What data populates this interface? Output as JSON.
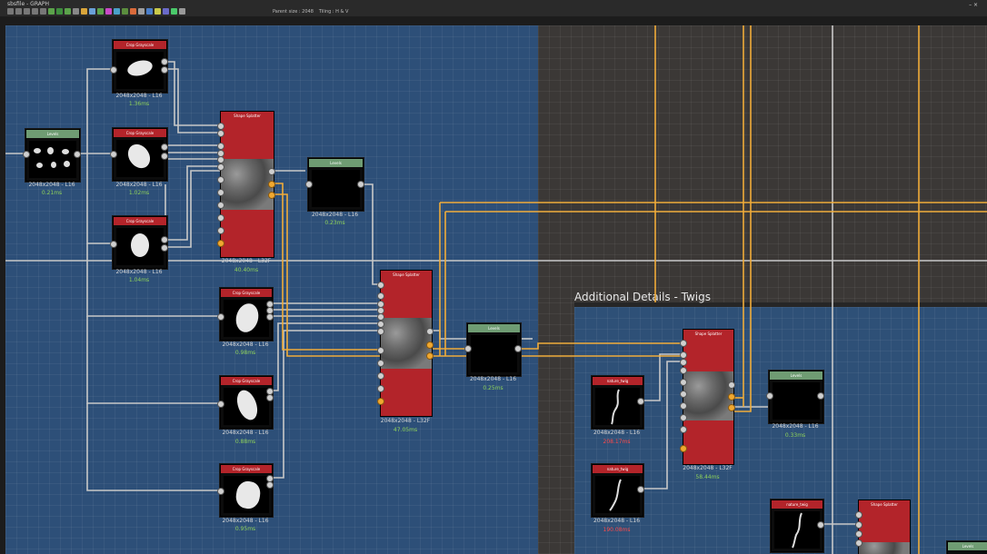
{
  "window": {
    "title": "sbsfile - GRAPH",
    "controls": "– ×"
  },
  "toolbar": {
    "spacing_label": "Parent size : 2048",
    "tile_label": "Tiling : H & V",
    "button_colors": [
      "#777",
      "#777",
      "#777",
      "#777",
      "#777",
      "#5ba34b",
      "#3e8e3e",
      "#5ba34b",
      "#888",
      "#d9a53a",
      "#6aa0d8",
      "#5ba34b",
      "#c94ac7",
      "#4aa0c9",
      "#5b8e3e",
      "#d96a3a",
      "#9f9f9f",
      "#4a7ec9",
      "#c9c94a",
      "#6a6ac9",
      "#4ac96a",
      "#999"
    ]
  },
  "frames": {
    "twigs_title": "Additional Details - Twigs"
  },
  "nodes": {
    "crop1": {
      "title": "Crop Grayscale",
      "res": "2048x2048 - L16",
      "time": "1.36ms"
    },
    "levels_in": {
      "title": "Levels",
      "res": "2048x2048 - L16",
      "time": "0.21ms"
    },
    "crop2": {
      "title": "Crop Grayscale",
      "res": "2048x2048 - L16",
      "time": "1.02ms"
    },
    "crop3": {
      "title": "Crop Grayscale",
      "res": "2048x2048 - L16",
      "time": "1.04ms"
    },
    "splat1": {
      "title": "Shape Splatter",
      "res": "2048x2048 - L32F",
      "time": "40.40ms"
    },
    "levels1": {
      "title": "Levels",
      "res": "2048x2048 - L16",
      "time": "0.23ms"
    },
    "crop4": {
      "title": "Crop Grayscale",
      "res": "2048x2048 - L16",
      "time": "0.98ms"
    },
    "crop5": {
      "title": "Crop Grayscale",
      "res": "2048x2048 - L16",
      "time": "0.88ms"
    },
    "crop6": {
      "title": "Crop Grayscale",
      "res": "2048x2048 - L16",
      "time": "0.95ms"
    },
    "splat2": {
      "title": "Shape Splatter",
      "res": "2048x2048 - L32F",
      "time": "47.05ms"
    },
    "levels2": {
      "title": "Levels",
      "res": "2048x2048 - L16",
      "time": "0.25ms"
    },
    "twig1": {
      "title": "nature_twig",
      "res": "2048x2048 - L16",
      "time": "208.17ms"
    },
    "twig2": {
      "title": "nature_twig",
      "res": "2048x2048 - L16",
      "time": "190.08ms"
    },
    "splat3": {
      "title": "Shape Splatter",
      "res": "2048x2048 - L32F",
      "time": "58.44ms"
    },
    "levels3": {
      "title": "Levels",
      "res": "2048x2048 - L16",
      "time": "0.33ms"
    },
    "twig3": {
      "title": "nature_twig"
    },
    "splat4": {
      "title": "Shape Splatter"
    },
    "levels4": {
      "title": "Levels"
    }
  }
}
